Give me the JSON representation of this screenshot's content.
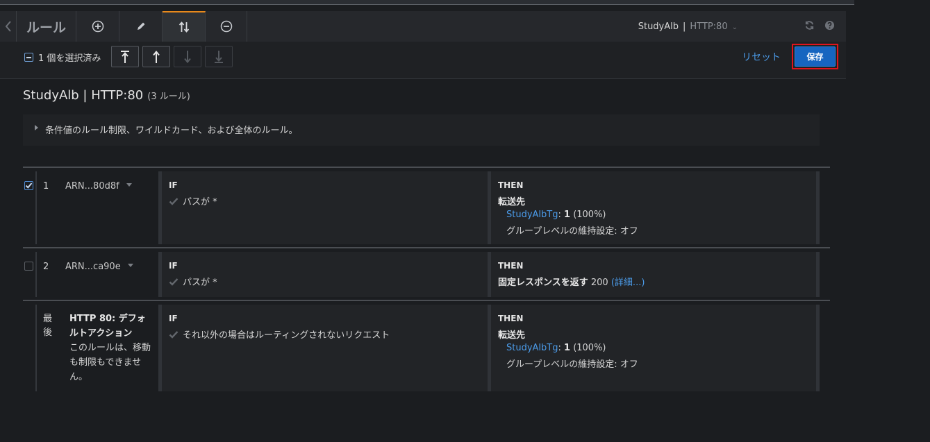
{
  "tabs": {
    "title": "ルール",
    "listener_name": "StudyAlb",
    "listener_sep": "|",
    "listener_port": "HTTP:80"
  },
  "toolbar": {
    "selected_label": "1 個を選択済み",
    "reset_label": "リセット",
    "save_label": "保存"
  },
  "page": {
    "title": "StudyAlb | HTTP:80",
    "rule_count": "(3 ルール)",
    "info_text": "条件値のルール制限、ワイルドカード、および全体のルール。"
  },
  "rules": [
    {
      "priority": "1",
      "arn": "ARN...80d8f",
      "checked": true,
      "if_label": "IF",
      "condition": "パスが *",
      "then_label": "THEN",
      "action": "転送先",
      "target_group": "StudyAlbTg",
      "weight_sep": ": ",
      "weight": "1",
      "weight_pct": "(100%)",
      "stickiness": "グループレベルの維持設定: オフ"
    },
    {
      "priority": "2",
      "arn": "ARN...ca90e",
      "checked": false,
      "if_label": "IF",
      "condition": "パスが *",
      "then_label": "THEN",
      "action": "固定レスポンスを返す",
      "status_code": "200",
      "details_link": "(詳細...)"
    },
    {
      "priority": "最後",
      "default_title": "HTTP 80: デフォルトアクション",
      "default_note": "このルールは、移動も制限もできません。",
      "if_label": "IF",
      "condition": "それ以外の場合はルーティングされないリクエスト",
      "then_label": "THEN",
      "action": "転送先",
      "target_group": "StudyAlbTg",
      "weight_sep": ": ",
      "weight": "1",
      "weight_pct": "(100%)",
      "stickiness": "グループレベルの維持設定: オフ"
    }
  ],
  "icons": {
    "back": "chevron-left-icon",
    "add": "plus-circle-icon",
    "edit": "pencil-icon",
    "reorder": "reorder-arrows-icon",
    "remove": "minus-circle-icon",
    "refresh": "refresh-icon",
    "help": "help-icon",
    "move_top": "move-to-top-icon",
    "move_up": "move-up-icon",
    "move_down": "move-down-icon",
    "move_bottom": "move-to-bottom-icon",
    "condition_check": "check-icon"
  },
  "colors": {
    "accent_tab": "#e8891b",
    "link": "#4b9be9",
    "primary_button": "#1665c0",
    "highlight_outline": "#e0141c"
  }
}
